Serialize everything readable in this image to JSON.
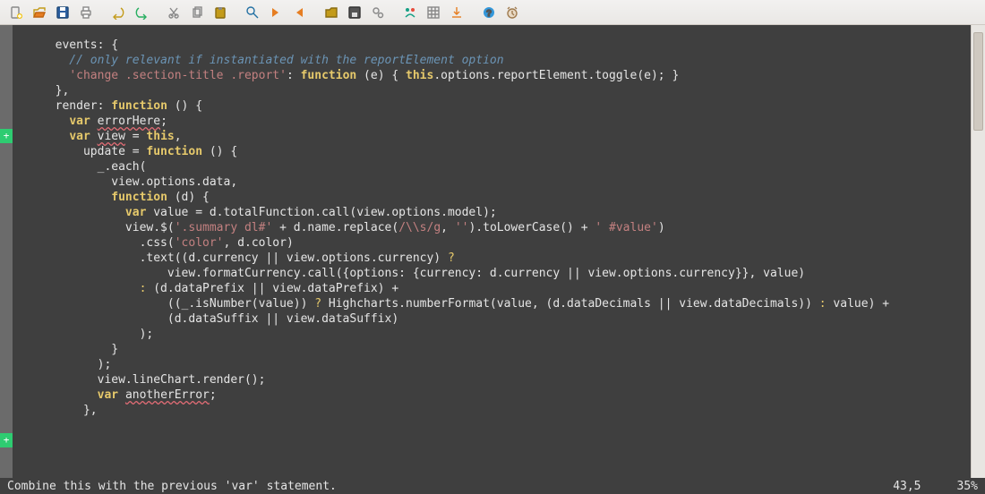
{
  "toolbar": {
    "icons": [
      {
        "name": "new-file-icon",
        "glyph": "new"
      },
      {
        "name": "open-file-icon",
        "glyph": "open"
      },
      {
        "name": "save-icon",
        "glyph": "save"
      },
      {
        "name": "print-icon",
        "glyph": "print"
      },
      {
        "sep": true
      },
      {
        "name": "undo-icon",
        "glyph": "undo"
      },
      {
        "name": "redo-icon",
        "glyph": "redo"
      },
      {
        "sep": true
      },
      {
        "name": "cut-icon",
        "glyph": "cut"
      },
      {
        "name": "copy-icon",
        "glyph": "copy"
      },
      {
        "name": "paste-icon",
        "glyph": "paste"
      },
      {
        "sep": true
      },
      {
        "name": "find-icon",
        "glyph": "find"
      },
      {
        "name": "find-next-icon",
        "glyph": "next"
      },
      {
        "name": "find-prev-icon",
        "glyph": "prev"
      },
      {
        "sep": true
      },
      {
        "name": "open-folder-icon",
        "glyph": "folder"
      },
      {
        "name": "save-all-icon",
        "glyph": "save2"
      },
      {
        "name": "preferences-icon",
        "glyph": "gears"
      },
      {
        "sep": true
      },
      {
        "name": "run-icon",
        "glyph": "run"
      },
      {
        "name": "grid-icon",
        "glyph": "grid"
      },
      {
        "name": "goto-icon",
        "glyph": "goto"
      },
      {
        "sep": true
      },
      {
        "name": "help-icon",
        "glyph": "help"
      },
      {
        "name": "alarm-icon",
        "glyph": "alarm"
      }
    ]
  },
  "gutter_marks": [
    {
      "line": 6,
      "mark": "+"
    },
    {
      "line": 26,
      "mark": "+"
    }
  ],
  "code": {
    "lines": [
      [
        [
          "id",
          "  events"
        ],
        [
          "id",
          ": {"
        ]
      ],
      [
        [
          "com",
          "    // only relevant if instantiated with the reportElement option"
        ]
      ],
      [
        [
          "id",
          "    "
        ],
        [
          "str",
          "'change .section-title .report'"
        ],
        [
          "id",
          ": "
        ],
        [
          "kw",
          "function"
        ],
        [
          "id",
          " (e) { "
        ],
        [
          "kw",
          "this"
        ],
        [
          "id",
          ".options.reportElement.toggle(e); }"
        ]
      ],
      [
        [
          "id",
          "  },"
        ]
      ],
      [
        [
          "id",
          ""
        ]
      ],
      [
        [
          "id",
          "  render: "
        ],
        [
          "kw",
          "function"
        ],
        [
          "id",
          " () {"
        ]
      ],
      [
        [
          "id",
          "    "
        ],
        [
          "kw",
          "var"
        ],
        [
          "id",
          " "
        ],
        [
          "err",
          "errorHere"
        ],
        [
          "id",
          ";"
        ]
      ],
      [
        [
          "id",
          "    "
        ],
        [
          "kw",
          "var"
        ],
        [
          "id",
          " "
        ],
        [
          "err",
          "view"
        ],
        [
          "id",
          " = "
        ],
        [
          "kw",
          "this"
        ],
        [
          "id",
          ","
        ]
      ],
      [
        [
          "id",
          "      update = "
        ],
        [
          "kw",
          "function"
        ],
        [
          "id",
          " () {"
        ]
      ],
      [
        [
          "id",
          "        _.each("
        ]
      ],
      [
        [
          "id",
          "          view.options.data,"
        ]
      ],
      [
        [
          "id",
          "          "
        ],
        [
          "kw",
          "function"
        ],
        [
          "id",
          " (d) {"
        ]
      ],
      [
        [
          "id",
          "            "
        ],
        [
          "kw",
          "var"
        ],
        [
          "id",
          " value = d.totalFunction.call(view.options.model);"
        ]
      ],
      [
        [
          "id",
          "            view.$("
        ],
        [
          "str",
          "'.summary dl#'"
        ],
        [
          "id",
          " + d.name.replace("
        ],
        [
          "rx",
          "/\\\\s/g"
        ],
        [
          "id",
          ", "
        ],
        [
          "str",
          "''"
        ],
        [
          "id",
          ").toLowerCase() + "
        ],
        [
          "str",
          "' #value'"
        ],
        [
          "id",
          ")"
        ]
      ],
      [
        [
          "id",
          "              .css("
        ],
        [
          "str",
          "'color'"
        ],
        [
          "id",
          ", d.color)"
        ]
      ],
      [
        [
          "id",
          "              .text((d.currency || view.options.currency) "
        ],
        [
          "kw2",
          "?"
        ]
      ],
      [
        [
          "id",
          "                  view.formatCurrency.call({options: {currency: d.currency || view.options.currency}}, value)"
        ]
      ],
      [
        [
          "id",
          "              "
        ],
        [
          "kw2",
          ":"
        ],
        [
          "id",
          " (d.dataPrefix || view.dataPrefix) +"
        ]
      ],
      [
        [
          "id",
          "                  ((_.isNumber(value)) "
        ],
        [
          "kw2",
          "?"
        ],
        [
          "id",
          " Highcharts.numberFormat(value, (d.dataDecimals || view.dataDecimals)) "
        ],
        [
          "kw2",
          ":"
        ],
        [
          "id",
          " value) +"
        ]
      ],
      [
        [
          "id",
          "                  (d.dataSuffix || view.dataSuffix)"
        ]
      ],
      [
        [
          "id",
          "              );"
        ]
      ],
      [
        [
          "id",
          "          }"
        ]
      ],
      [
        [
          "id",
          "        );"
        ]
      ],
      [
        [
          "id",
          ""
        ]
      ],
      [
        [
          "id",
          "        view.lineChart.render();"
        ]
      ],
      [
        [
          "id",
          "        "
        ],
        [
          "kw",
          "var"
        ],
        [
          "id",
          " "
        ],
        [
          "err",
          "anotherError"
        ],
        [
          "id",
          ";"
        ]
      ],
      [
        [
          "id",
          ""
        ]
      ],
      [
        [
          "id",
          "      },"
        ]
      ]
    ]
  },
  "status": {
    "message": "Combine this with the previous 'var' statement.",
    "cursor": "43,5",
    "percent": "35%"
  }
}
